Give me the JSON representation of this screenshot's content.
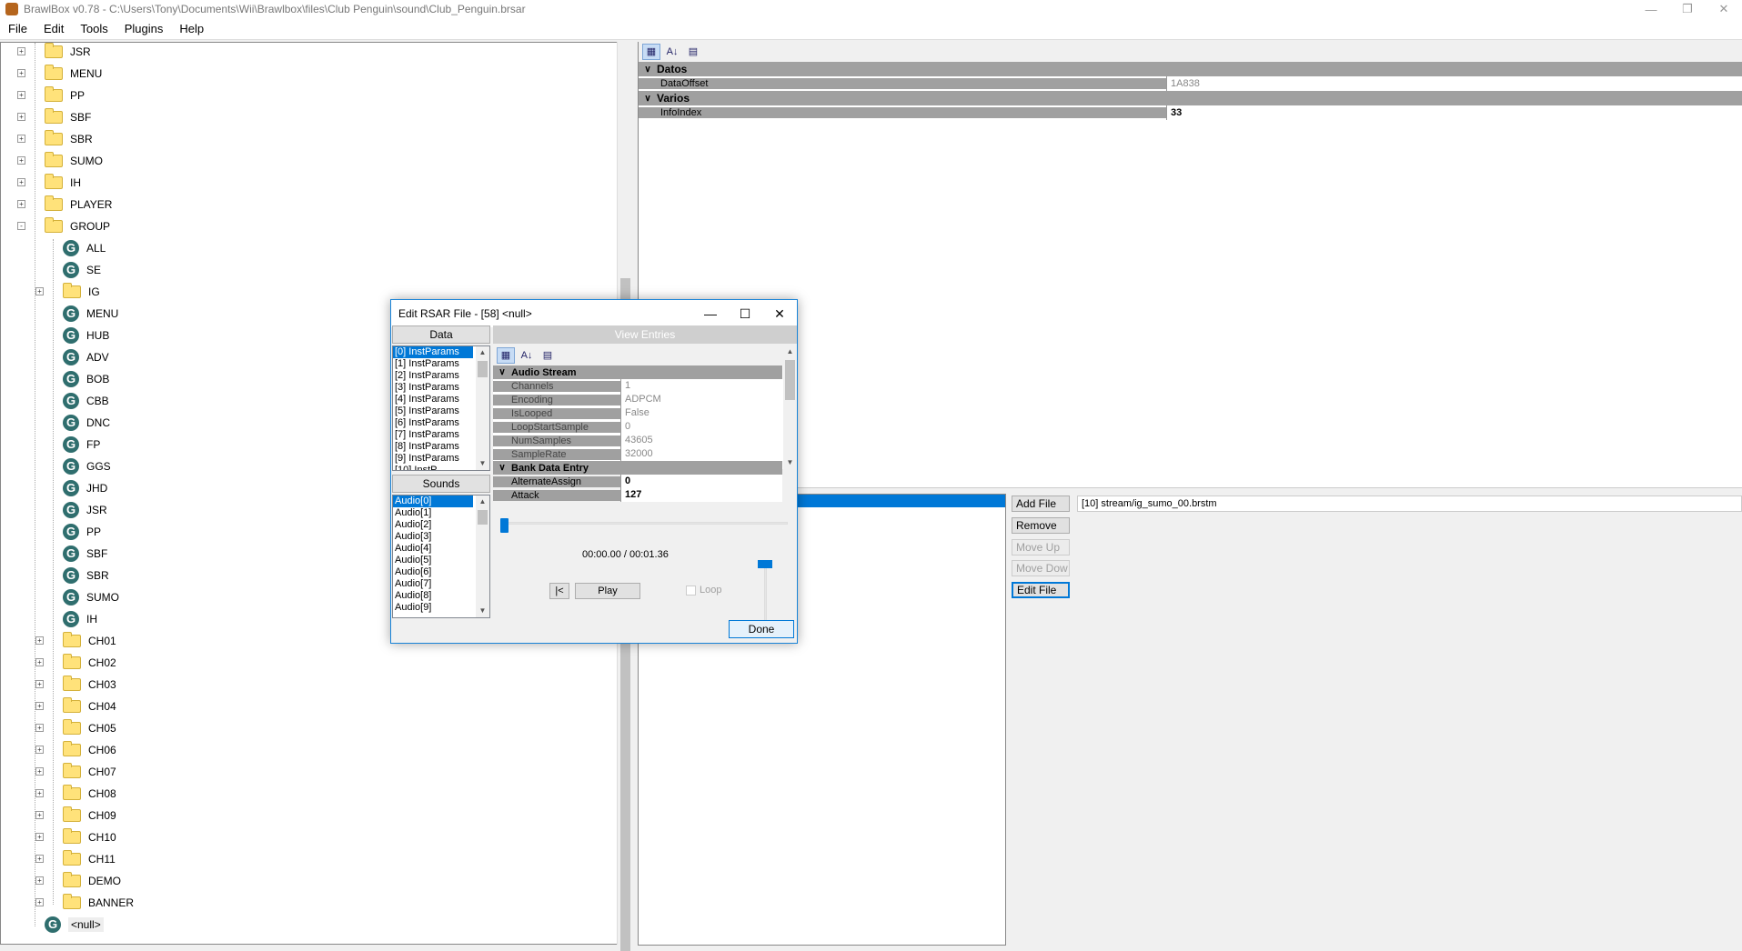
{
  "window": {
    "title": "BrawlBox v0.78 - C:\\Users\\Tony\\Documents\\Wii\\Brawlbox\\files\\Club Penguin\\sound\\Club_Penguin.brsar"
  },
  "menu": [
    "File",
    "Edit",
    "Tools",
    "Plugins",
    "Help"
  ],
  "tree": {
    "top_folders": [
      "JSR",
      "MENU",
      "PP",
      "SBF",
      "SBR",
      "SUMO",
      "IH",
      "PLAYER",
      "GROUP"
    ],
    "group_children": [
      {
        "label": "ALL",
        "kind": "group"
      },
      {
        "label": "SE",
        "kind": "group"
      },
      {
        "label": "IG",
        "kind": "folder"
      },
      {
        "label": "MENU",
        "kind": "group"
      },
      {
        "label": "HUB",
        "kind": "group"
      },
      {
        "label": "ADV",
        "kind": "group"
      },
      {
        "label": "BOB",
        "kind": "group"
      },
      {
        "label": "CBB",
        "kind": "group"
      },
      {
        "label": "DNC",
        "kind": "group"
      },
      {
        "label": "FP",
        "kind": "group"
      },
      {
        "label": "GGS",
        "kind": "group"
      },
      {
        "label": "JHD",
        "kind": "group"
      },
      {
        "label": "JSR",
        "kind": "group"
      },
      {
        "label": "PP",
        "kind": "group"
      },
      {
        "label": "SBF",
        "kind": "group"
      },
      {
        "label": "SBR",
        "kind": "group"
      },
      {
        "label": "SUMO",
        "kind": "group"
      },
      {
        "label": "IH",
        "kind": "group"
      },
      {
        "label": "CH01",
        "kind": "folder"
      },
      {
        "label": "CH02",
        "kind": "folder"
      },
      {
        "label": "CH03",
        "kind": "folder"
      },
      {
        "label": "CH04",
        "kind": "folder"
      },
      {
        "label": "CH05",
        "kind": "folder"
      },
      {
        "label": "CH06",
        "kind": "folder"
      },
      {
        "label": "CH07",
        "kind": "folder"
      },
      {
        "label": "CH08",
        "kind": "folder"
      },
      {
        "label": "CH09",
        "kind": "folder"
      },
      {
        "label": "CH10",
        "kind": "folder"
      },
      {
        "label": "CH11",
        "kind": "folder"
      },
      {
        "label": "DEMO",
        "kind": "folder"
      },
      {
        "label": "BANNER",
        "kind": "folder"
      }
    ],
    "selected_node": "<null>"
  },
  "propgrid": {
    "cat1": "Datos",
    "cat1_rows": [
      {
        "name": "DataOffset",
        "value": "1A838"
      }
    ],
    "cat2": "Varios",
    "cat2_rows": [
      {
        "name": "InfoIndex",
        "value": "33"
      }
    ]
  },
  "lower": {
    "buttons": {
      "add": "Add File",
      "remove": "Remove",
      "up": "Move Up",
      "down": "Move Dow",
      "edit": "Edit File"
    },
    "path": "[10] stream/ig_sumo_00.brstm"
  },
  "dialog": {
    "title": "Edit RSAR File - [58] <null>",
    "data_header": "Data",
    "data_items": [
      "[0] InstParams",
      "[1] InstParams",
      "[2] InstParams",
      "[3] InstParams",
      "[4] InstParams",
      "[5] InstParams",
      "[6] InstParams",
      "[7] InstParams",
      "[8] InstParams",
      "[9] InstParams",
      "[10] InstP"
    ],
    "sounds_header": "Sounds",
    "sound_items": [
      "Audio[0]",
      "Audio[1]",
      "Audio[2]",
      "Audio[3]",
      "Audio[4]",
      "Audio[5]",
      "Audio[6]",
      "Audio[7]",
      "Audio[8]",
      "Audio[9]"
    ],
    "view_entries": "View Entries",
    "cat_audio": "Audio Stream",
    "audio_rows": [
      {
        "name": "Channels",
        "value": "1"
      },
      {
        "name": "Encoding",
        "value": "ADPCM"
      },
      {
        "name": "IsLooped",
        "value": "False"
      },
      {
        "name": "LoopStartSample",
        "value": "0"
      },
      {
        "name": "NumSamples",
        "value": "43605"
      },
      {
        "name": "SampleRate",
        "value": "32000"
      }
    ],
    "cat_bank": "Bank Data Entry",
    "bank_rows": [
      {
        "name": "AlternateAssign",
        "value": "0"
      },
      {
        "name": "Attack",
        "value": "127"
      }
    ],
    "time": "00:00.00 / 00:01.36",
    "rewind": "|<",
    "play": "Play",
    "loop": "Loop",
    "done": "Done"
  }
}
